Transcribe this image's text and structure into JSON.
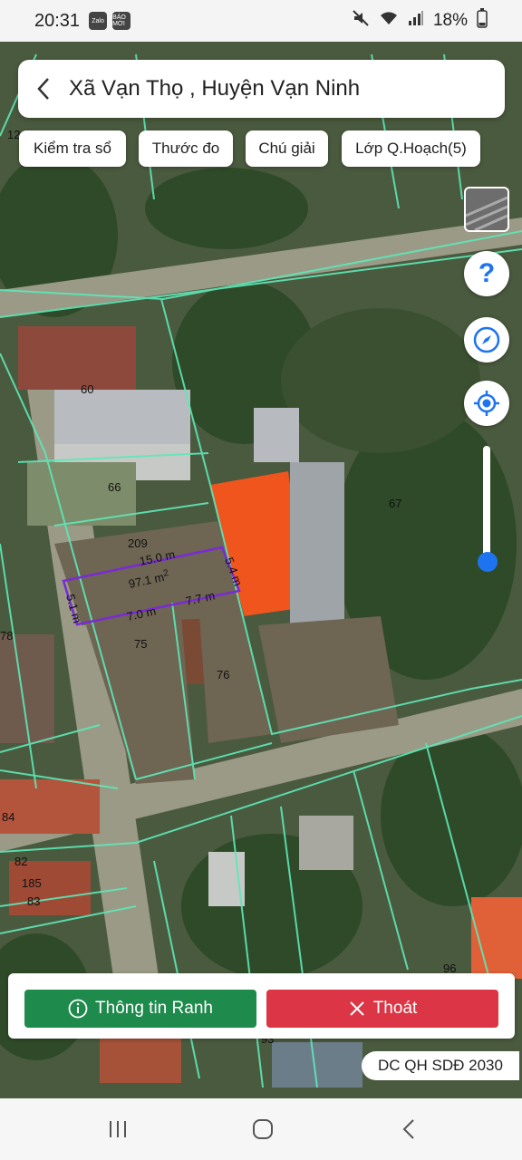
{
  "status": {
    "time": "20:31",
    "battery": "18%",
    "app_icons": [
      "Zalo",
      "BÁO MỚI"
    ]
  },
  "header": {
    "title": "Xã Vạn Thọ , Huyện Vạn Ninh"
  },
  "toolbar": {
    "check_label": "Kiểm tra sổ",
    "measure_label": "Thước đo",
    "legend_label": "Chú giải",
    "layer_label": "Lớp Q.Hoạch(5)"
  },
  "map": {
    "parcel_numbers": [
      "12",
      "60",
      "66",
      "67",
      "209",
      "75",
      "76",
      "78",
      "84",
      "82",
      "185",
      "83",
      "96",
      "93"
    ],
    "measurements": {
      "top": "15.0 m",
      "right": "5.4 m",
      "left": "5.1 m",
      "bottom_left": "7.0 m",
      "bottom_right": "7.7 m",
      "area": "97.1 m",
      "area_unit_sup": "2"
    }
  },
  "controls": {
    "help_icon": "question-icon",
    "compass_icon": "compass-icon",
    "locate_icon": "locate-icon"
  },
  "zoom_slider": {
    "value": 0.1
  },
  "bottom": {
    "info_label": "Thông tin Ranh",
    "exit_label": "Thoát"
  },
  "plan_badge": "DC QH SDĐ 2030",
  "colors": {
    "green": "#1e8a4c",
    "red": "#dc3545",
    "parcel_line": "#5ee8b8",
    "measure_line": "#7a2ad6",
    "roof": "#f0551e"
  }
}
